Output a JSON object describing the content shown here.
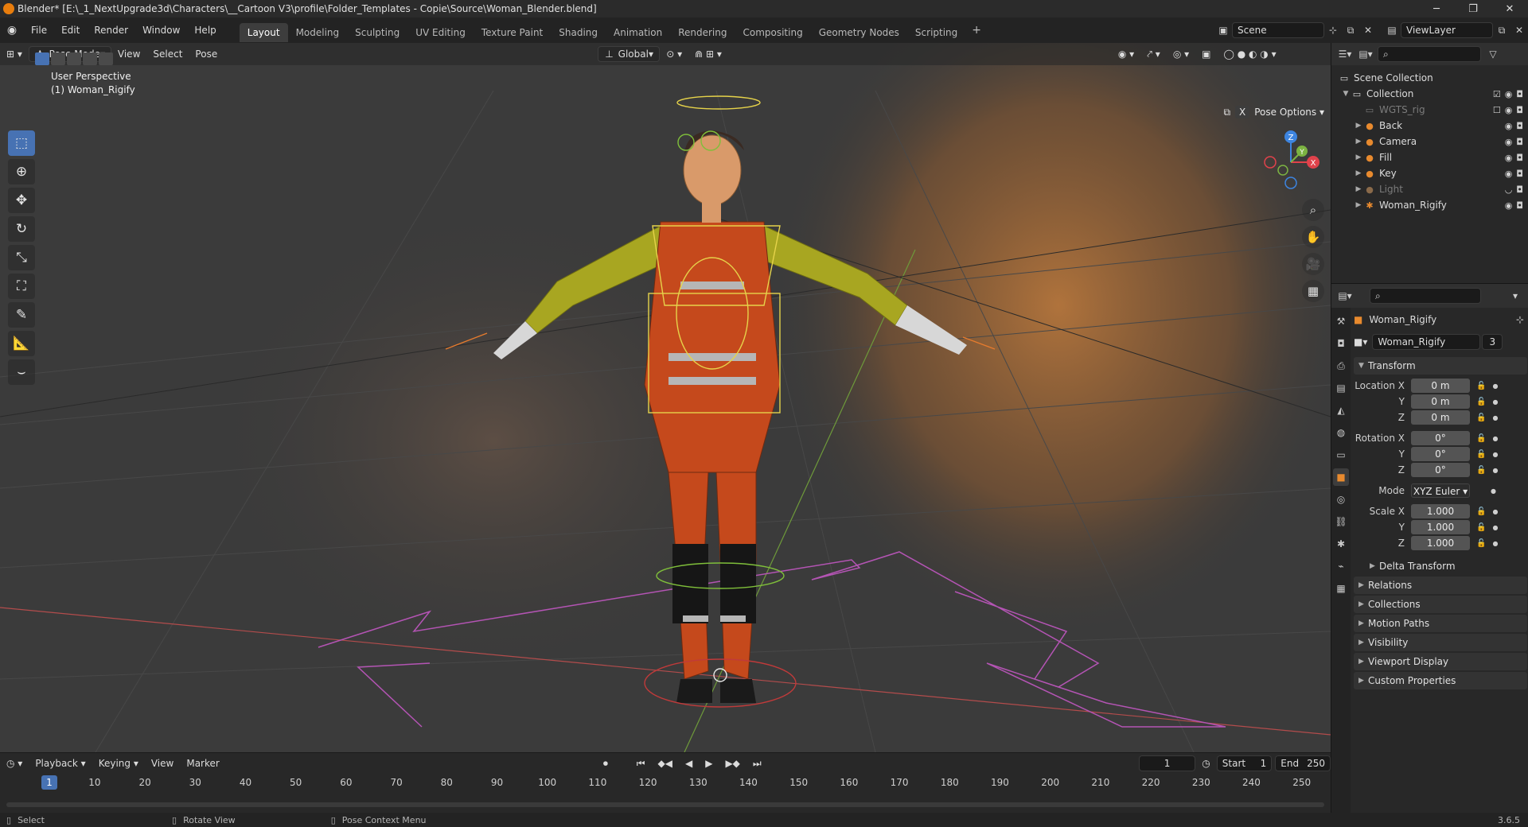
{
  "titlebar": {
    "title": "Blender* [E:\\_1_NextUpgrade3d\\Characters\\__Cartoon V3\\profile\\Folder_Templates - Copie\\Source\\Woman_Blender.blend]",
    "minimize": "─",
    "maximize": "❐",
    "close": "✕"
  },
  "menu": {
    "items": [
      "File",
      "Edit",
      "Render",
      "Window",
      "Help"
    ],
    "workspaces": [
      "Layout",
      "Modeling",
      "Sculpting",
      "UV Editing",
      "Texture Paint",
      "Shading",
      "Animation",
      "Rendering",
      "Compositing",
      "Geometry Nodes",
      "Scripting"
    ],
    "active_workspace": "Layout",
    "add": "+",
    "scene": "Scene",
    "view_layer": "ViewLayer"
  },
  "viewport": {
    "mode": "Pose Mode",
    "menus": [
      "View",
      "Select",
      "Pose"
    ],
    "orientation": "Global",
    "perspective_label": "User Perspective",
    "object_label": "(1) Woman_Rigify",
    "pose_options": "Pose Options",
    "x_mirror": "X",
    "gizmo": {
      "z": "Z",
      "y": "Y",
      "x": "X"
    }
  },
  "timeline": {
    "menus": [
      "Playback",
      "Keying",
      "View",
      "Marker"
    ],
    "current_frame": "1",
    "start_label": "Start",
    "start": "1",
    "end_label": "End",
    "end": "250",
    "ticks": [
      "1",
      "10",
      "20",
      "30",
      "40",
      "50",
      "60",
      "70",
      "80",
      "90",
      "100",
      "110",
      "120",
      "130",
      "140",
      "150",
      "160",
      "170",
      "180",
      "190",
      "200",
      "210",
      "220",
      "230",
      "240",
      "250"
    ]
  },
  "statusbar": {
    "select": "Select",
    "rotate": "Rotate View",
    "context": "Pose Context Menu",
    "version": "3.6.5"
  },
  "outliner": {
    "scene_collection": "Scene Collection",
    "collection": "Collection",
    "items": [
      {
        "name": "WGTS_rig",
        "dim": true
      },
      {
        "name": "Back",
        "dim": false
      },
      {
        "name": "Camera",
        "dim": false
      },
      {
        "name": "Fill",
        "dim": false
      },
      {
        "name": "Key",
        "dim": false
      },
      {
        "name": "Light",
        "dim": true
      },
      {
        "name": "Woman_Rigify",
        "dim": false
      }
    ]
  },
  "properties": {
    "object_name": "Woman_Rigify",
    "datablock": "Woman_Rigify",
    "users": "3",
    "transform_label": "Transform",
    "location_label": "Location X",
    "rotation_label": "Rotation X",
    "scale_label": "Scale X",
    "y": "Y",
    "z": "Z",
    "location": [
      "0 m",
      "0 m",
      "0 m"
    ],
    "rotation": [
      "0°",
      "0°",
      "0°"
    ],
    "mode_label": "Mode",
    "mode_value": "XYZ Euler",
    "scale": [
      "1.000",
      "1.000",
      "1.000"
    ],
    "delta_transform": "Delta Transform",
    "panels": [
      "Relations",
      "Collections",
      "Motion Paths",
      "Visibility",
      "Viewport Display",
      "Custom Properties"
    ]
  },
  "colors": {
    "accent": "#4772b3",
    "blender_orange": "#e87d0d",
    "axis_x": "#e0424b",
    "axis_y": "#7cb342",
    "axis_z": "#3d85e0"
  }
}
